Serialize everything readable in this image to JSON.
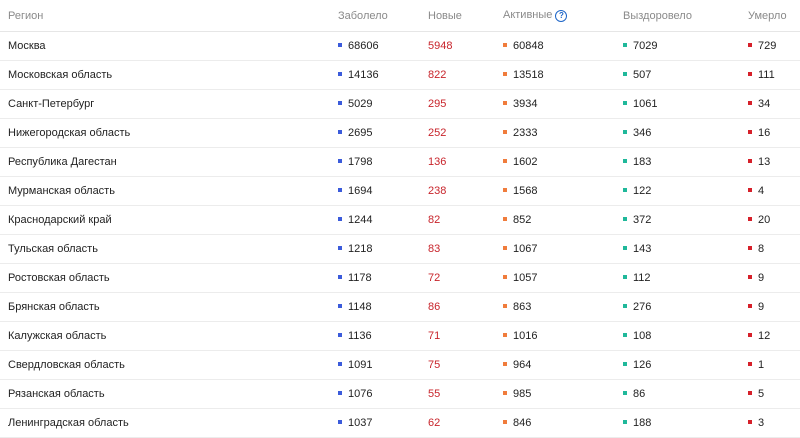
{
  "colors": {
    "cases": "#3b5bdb",
    "new": "#c8242b",
    "active": "#f07c3c",
    "recovered": "#1fb89a",
    "deaths": "#d6202a"
  },
  "header": {
    "region": "Регион",
    "cases": "Заболело",
    "new": "Новые",
    "active": "Активные",
    "active_help_icon": "question-circle-icon",
    "active_help_glyph": "?",
    "recovered": "Выздоровело",
    "deaths": "Умерло"
  },
  "rows": [
    {
      "region": "Москва",
      "cases": "68606",
      "new": "5948",
      "active": "60848",
      "recovered": "7029",
      "deaths": "729"
    },
    {
      "region": "Московская область",
      "cases": "14136",
      "new": "822",
      "active": "13518",
      "recovered": "507",
      "deaths": "111"
    },
    {
      "region": "Санкт-Петербург",
      "cases": "5029",
      "new": "295",
      "active": "3934",
      "recovered": "1061",
      "deaths": "34"
    },
    {
      "region": "Нижегородская область",
      "cases": "2695",
      "new": "252",
      "active": "2333",
      "recovered": "346",
      "deaths": "16"
    },
    {
      "region": "Республика Дагестан",
      "cases": "1798",
      "new": "136",
      "active": "1602",
      "recovered": "183",
      "deaths": "13"
    },
    {
      "region": "Мурманская область",
      "cases": "1694",
      "new": "238",
      "active": "1568",
      "recovered": "122",
      "deaths": "4"
    },
    {
      "region": "Краснодарский край",
      "cases": "1244",
      "new": "82",
      "active": "852",
      "recovered": "372",
      "deaths": "20"
    },
    {
      "region": "Тульская область",
      "cases": "1218",
      "new": "83",
      "active": "1067",
      "recovered": "143",
      "deaths": "8"
    },
    {
      "region": "Ростовская область",
      "cases": "1178",
      "new": "72",
      "active": "1057",
      "recovered": "112",
      "deaths": "9"
    },
    {
      "region": "Брянская область",
      "cases": "1148",
      "new": "86",
      "active": "863",
      "recovered": "276",
      "deaths": "9"
    },
    {
      "region": "Калужская область",
      "cases": "1136",
      "new": "71",
      "active": "1016",
      "recovered": "108",
      "deaths": "12"
    },
    {
      "region": "Свердловская область",
      "cases": "1091",
      "new": "75",
      "active": "964",
      "recovered": "126",
      "deaths": "1"
    },
    {
      "region": "Рязанская область",
      "cases": "1076",
      "new": "55",
      "active": "985",
      "recovered": "86",
      "deaths": "5"
    },
    {
      "region": "Ленинградская область",
      "cases": "1037",
      "new": "62",
      "active": "846",
      "recovered": "188",
      "deaths": "3"
    }
  ]
}
